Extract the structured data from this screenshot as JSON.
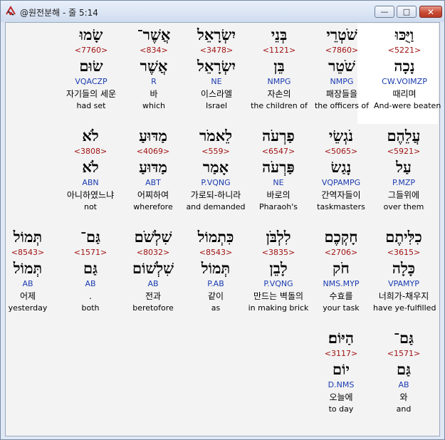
{
  "window": {
    "title": "@원전분해 - 줄 5:14",
    "buttons": {
      "minimize": "—",
      "maximize": "□",
      "close": "✕"
    }
  },
  "rows": [
    [
      {
        "orig": "וַיֻּכּוּ",
        "strong": "<5221>",
        "lemma": "נָכָה",
        "parse": "CW.VOIMZP",
        "ko": "때리며",
        "en": "And-were beaten"
      },
      {
        "orig": "שֹׁטְרֵי",
        "strong": "<7860>",
        "lemma": "שֹׁטֵר",
        "parse": "NMPG",
        "ko": "패장들을",
        "en": "the officers of"
      },
      {
        "orig": "בְּנֵי",
        "strong": "<1121>",
        "lemma": "בֵּן",
        "parse": "NMPG",
        "ko": "자손의",
        "en": "the children of"
      },
      {
        "orig": "יִשְׂרָאֵל",
        "strong": "<3478>",
        "lemma": "יִשְׂרָאֵל",
        "parse": "NE",
        "ko": "이스라엘",
        "en": "Israel"
      },
      {
        "orig": "אֲשֶׁר־",
        "strong": "<834>",
        "lemma": "אֲשֶׁר",
        "parse": "R",
        "ko": "바",
        "en": "which"
      },
      {
        "orig": "שָׂמוּ",
        "strong": "<7760>",
        "lemma": "שׂוּם",
        "parse": "VQACZP",
        "ko": "자기들의 세운",
        "en": "had set"
      }
    ],
    [
      {
        "orig": "עֲלֵהֶם",
        "strong": "<5921>",
        "lemma": "עַל",
        "parse": "P.MZP",
        "ko": "그들위에",
        "en": "over them"
      },
      {
        "orig": "נֹגְשֵׂי",
        "strong": "<5065>",
        "lemma": "נָגַשׂ",
        "parse": "VQPAMPG",
        "ko": "간역자들이",
        "en": "taskmasters"
      },
      {
        "orig": "פַרְעֹה",
        "strong": "<6547>",
        "lemma": "פַּרְעֹה",
        "parse": "NE",
        "ko": "바로의",
        "en": "Pharaoh's"
      },
      {
        "orig": "לֵאמֹר",
        "strong": "<559>",
        "lemma": "אָמַר",
        "parse": "P.VQNG",
        "ko": "가로되-하니라",
        "en": "and demanded"
      },
      {
        "orig": "מַדּוּעַ",
        "strong": "<4069>",
        "lemma": "מַדּוּעַ",
        "parse": "ABT",
        "ko": "어찌하여",
        "en": "wherefore"
      },
      {
        "orig": "לֹא",
        "strong": "<3808>",
        "lemma": "לֹא",
        "parse": "ABN",
        "ko": "아니하였느냐",
        "en": "not"
      }
    ],
    [
      {
        "orig": "כִלִּיתֶם",
        "strong": "<3615>",
        "lemma": "כָּלָה",
        "parse": "VPAMYP",
        "ko": "너희가-채우지",
        "en": "have ye-fulfilled"
      },
      {
        "orig": "חָקְכֶם",
        "strong": "<2706>",
        "lemma": "חֹק",
        "parse": "NMS.MYP",
        "ko": "수효를",
        "en": "your task"
      },
      {
        "orig": "לִלְבֹּן",
        "strong": "<3835>",
        "lemma": "לָבֵן",
        "parse": "P.VQNG",
        "ko": "만드는 벽돌의",
        "en": "in making brick"
      },
      {
        "orig": "כִּתְמוֹל",
        "strong": "<8543>",
        "lemma": "תְּמוֹל",
        "parse": "P.AB",
        "ko": "같이",
        "en": "as"
      },
      {
        "orig": "שִׁלְשֹׁם",
        "strong": "<8032>",
        "lemma": "שִׁלְשׁוֹם",
        "parse": "AB",
        "ko": "전과",
        "en": "beretofore"
      },
      {
        "orig": "גַּם־",
        "strong": "<1571>",
        "lemma": "גַּם",
        "parse": "AB",
        "ko": ".",
        "en": "both"
      },
      {
        "orig": "תְּמוֹל",
        "strong": "<8543>",
        "lemma": "תְּמוֹל",
        "parse": "AB",
        "ko": "어제",
        "en": "yesterday"
      }
    ],
    [
      {
        "orig": "גַּם־",
        "strong": "<1571>",
        "lemma": "גַּם",
        "parse": "AB",
        "ko": "와",
        "en": "and"
      },
      {
        "orig": "הַיּוֹם׃",
        "strong": "<3117>",
        "lemma": "יוֹם",
        "parse": "D.NMS",
        "ko": "오늘에",
        "en": "to day"
      }
    ]
  ]
}
